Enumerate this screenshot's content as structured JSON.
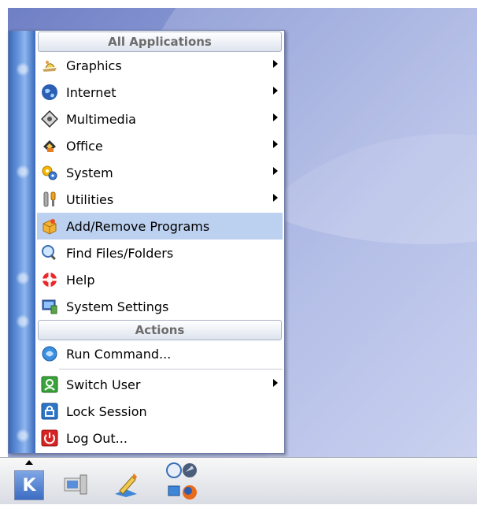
{
  "menu": {
    "header_apps": "All Applications",
    "header_actions": "Actions",
    "app_items": [
      {
        "label": "Graphics",
        "icon": "graphics-icon",
        "submenu": true
      },
      {
        "label": "Internet",
        "icon": "internet-globe-icon",
        "submenu": true
      },
      {
        "label": "Multimedia",
        "icon": "multimedia-icon",
        "submenu": true
      },
      {
        "label": "Office",
        "icon": "office-icon",
        "submenu": true
      },
      {
        "label": "System",
        "icon": "system-gears-icon",
        "submenu": true
      },
      {
        "label": "Utilities",
        "icon": "utilities-icon",
        "submenu": true
      },
      {
        "label": "Add/Remove Programs",
        "icon": "package-icon",
        "submenu": false,
        "highlighted": true
      },
      {
        "label": "Find Files/Folders",
        "icon": "find-icon",
        "submenu": false
      },
      {
        "label": "Help",
        "icon": "help-lifebuoy-icon",
        "submenu": false
      },
      {
        "label": "System Settings",
        "icon": "system-settings-icon",
        "submenu": false
      }
    ],
    "action_items": [
      {
        "label": "Run Command...",
        "icon": "run-command-icon",
        "submenu": false
      },
      {
        "label": "Switch User",
        "icon": "switch-user-icon",
        "submenu": true
      },
      {
        "label": "Lock Session",
        "icon": "lock-icon",
        "submenu": false
      },
      {
        "label": "Log Out...",
        "icon": "logout-icon",
        "submenu": false
      }
    ]
  },
  "taskbar": {
    "kmenu_label": "K",
    "launchers": [
      "kmenu-icon",
      "computer-icon",
      "kwrite-icon",
      "konqueror-icon",
      "firefox-icon"
    ]
  },
  "colors": {
    "highlight": "#bcd0ef",
    "sidebar": "#3a69b9"
  }
}
